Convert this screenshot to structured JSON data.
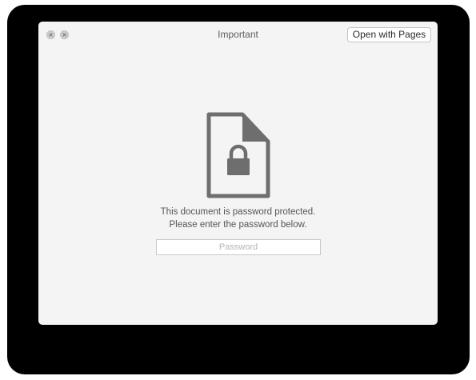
{
  "window": {
    "title": "Important",
    "open_button_label": "Open with Pages"
  },
  "message": {
    "line1": "This document is password protected.",
    "line2": "Please enter the password below."
  },
  "password": {
    "placeholder": "Password",
    "value": ""
  },
  "icons": {
    "close": "close-icon",
    "minimize": "minimize-icon",
    "document": "locked-document-icon"
  },
  "colors": {
    "window_bg": "#f4f4f4",
    "icon_gray": "#6e6e6e",
    "text_gray": "#555555"
  }
}
